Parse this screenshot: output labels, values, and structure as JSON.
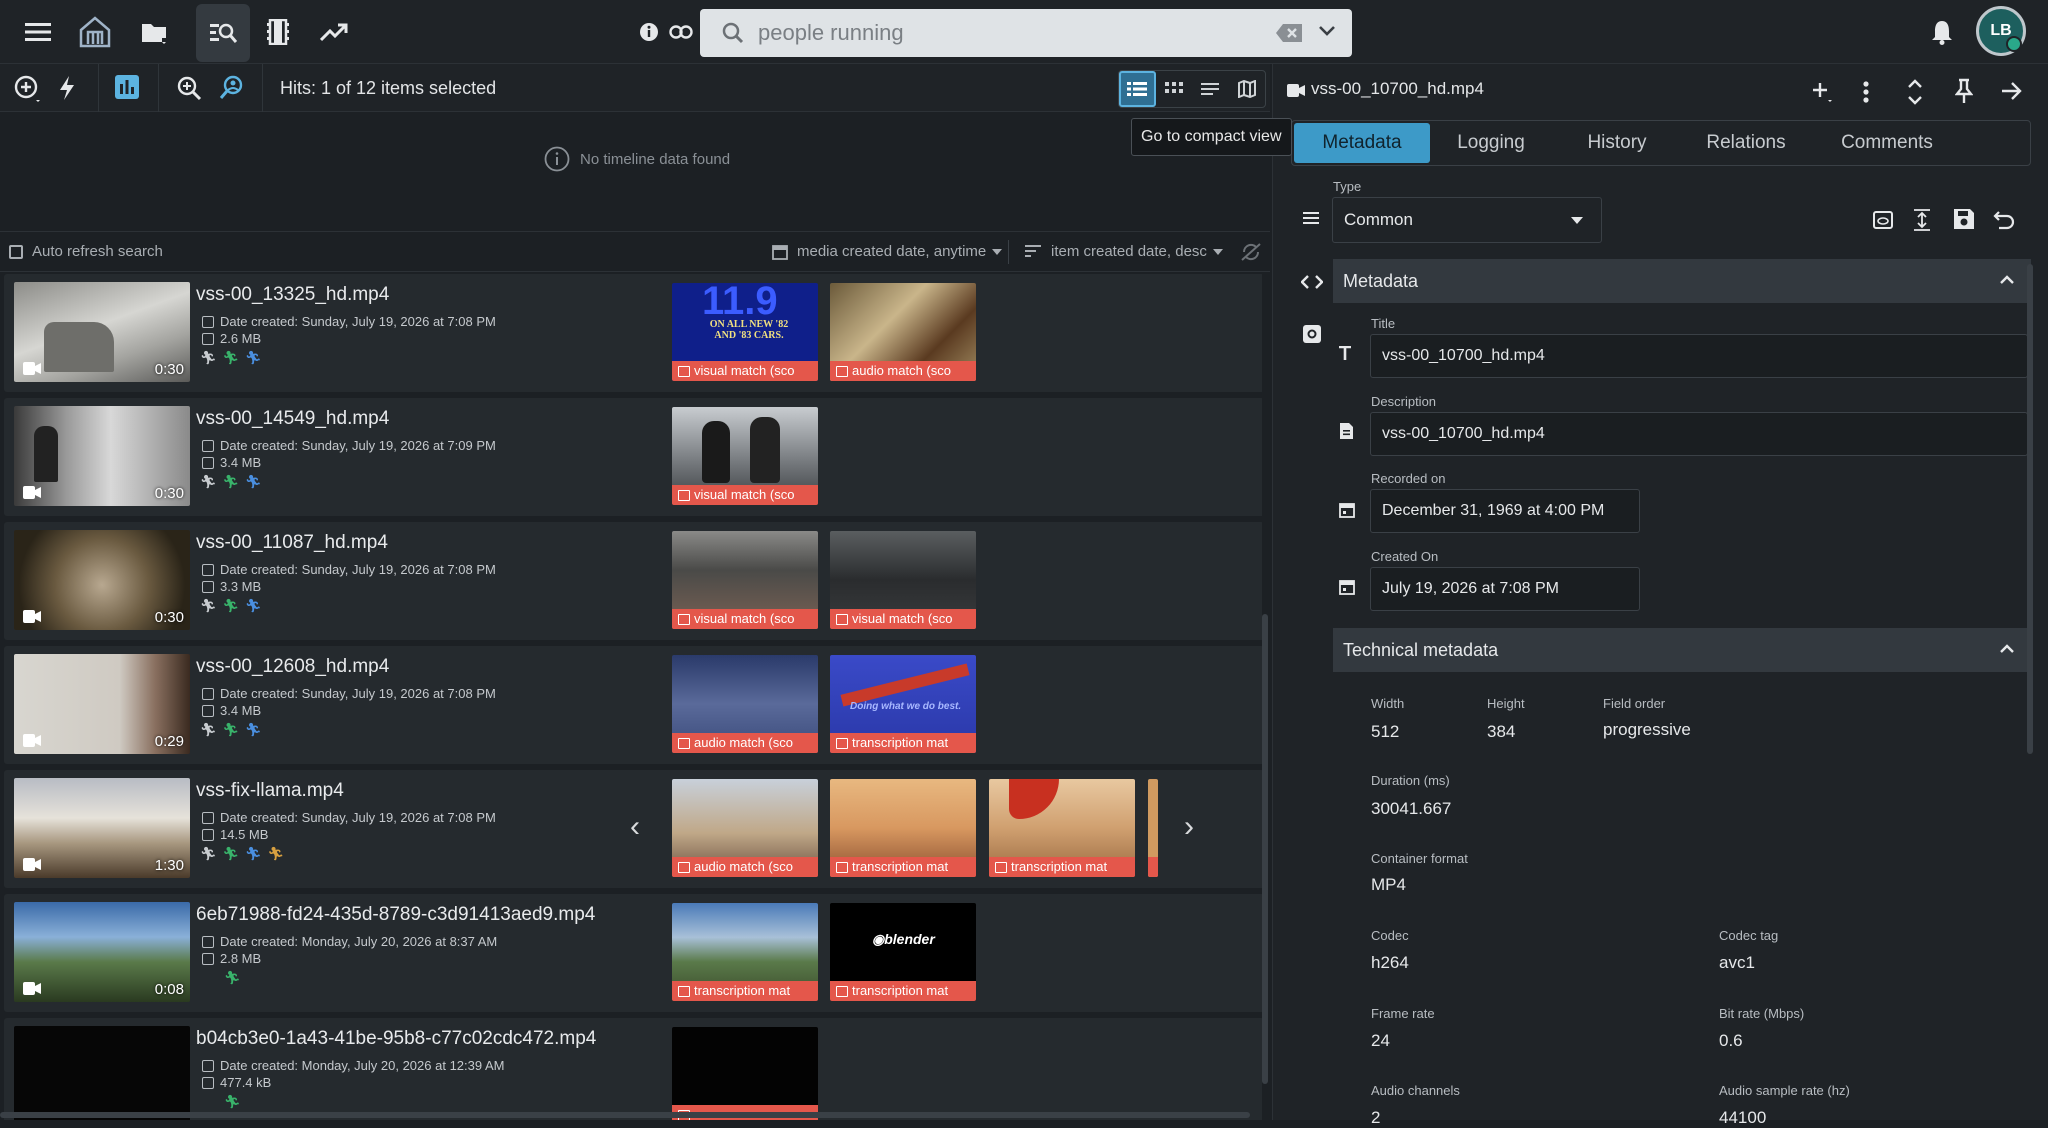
{
  "search": {
    "placeholder": "people running"
  },
  "user": {
    "initials": "LB"
  },
  "toolbar": {
    "hits": "Hits: 1 of 12 items selected",
    "tooltip": "Go to compact view"
  },
  "timeline": {
    "empty": "No timeline data found"
  },
  "filters": {
    "auto_refresh": "Auto refresh search",
    "date_filter": "media created date, anytime",
    "sort": "item created date, desc"
  },
  "results": [
    {
      "name": "vss-00_13325_hd.mp4",
      "date": "Date created: Sunday, July 19, 2026 at 7:08 PM",
      "size": "2.6 MB",
      "duration": "0:30",
      "matches": [
        "visual match (sco",
        "audio match (sco"
      ]
    },
    {
      "name": "vss-00_14549_hd.mp4",
      "date": "Date created: Sunday, July 19, 2026 at 7:09 PM",
      "size": "3.4 MB",
      "duration": "0:30",
      "matches": [
        "visual match (sco"
      ]
    },
    {
      "name": "vss-00_11087_hd.mp4",
      "date": "Date created: Sunday, July 19, 2026 at 7:08 PM",
      "size": "3.3 MB",
      "duration": "0:30",
      "matches": [
        "visual match (sco",
        "visual match (sco"
      ]
    },
    {
      "name": "vss-00_12608_hd.mp4",
      "date": "Date created: Sunday, July 19, 2026 at 7:08 PM",
      "size": "3.4 MB",
      "duration": "0:29",
      "matches": [
        "audio match (sco",
        "transcription mat"
      ]
    },
    {
      "name": "vss-fix-llama.mp4",
      "date": "Date created: Sunday, July 19, 2026 at 7:08 PM",
      "size": "14.5 MB",
      "duration": "1:30",
      "matches": [
        "audio match (sco",
        "transcription mat",
        "transcription mat"
      ]
    },
    {
      "name": "6eb71988-fd24-435d-8789-c3d91413aed9.mp4",
      "date": "Date created: Monday, July 20, 2026 at 8:37 AM",
      "size": "2.8 MB",
      "duration": "0:08",
      "matches": [
        "transcription mat",
        "transcription mat"
      ]
    },
    {
      "name": "b04cb3e0-1a43-41be-95b8-c77c02cdc472.mp4",
      "date": "Date created: Monday, July 20, 2026 at 12:39 AM",
      "size": "477.4 kB",
      "duration": "",
      "matches": [
        ""
      ]
    }
  ],
  "match_thumb_texts": {
    "ad_number": "11.9",
    "ad_line": "ON ALL NEW '82 AND '83 CARS.",
    "plane_caption": "Doing what we do best.",
    "blender_logo": "blender"
  },
  "detail": {
    "filename": "vss-00_10700_hd.mp4",
    "tabs": [
      "Metadata",
      "Logging",
      "History",
      "Relations",
      "Comments"
    ],
    "type_label": "Type",
    "type_value": "Common",
    "metadata_section": "Metadata",
    "title_label": "Title",
    "title_value": "vss-00_10700_hd.mp4",
    "description_label": "Description",
    "description_value": "vss-00_10700_hd.mp4",
    "recorded_label": "Recorded on",
    "recorded_value": "December 31, 1969 at 4:00 PM",
    "created_label": "Created On",
    "created_value": "July 19, 2026 at 7:08 PM",
    "technical_section": "Technical metadata",
    "width_label": "Width",
    "width_value": "512",
    "height_label": "Height",
    "height_value": "384",
    "field_order_label": "Field order",
    "field_order_value": "progressive",
    "duration_label": "Duration (ms)",
    "duration_value": "30041.667",
    "container_label": "Container format",
    "container_value": "MP4",
    "codec_label": "Codec",
    "codec_value": "h264",
    "codec_tag_label": "Codec tag",
    "codec_tag_value": "avc1",
    "frame_rate_label": "Frame rate",
    "frame_rate_value": "24",
    "bit_rate_label": "Bit rate (Mbps)",
    "bit_rate_value": "0.6",
    "audio_channels_label": "Audio channels",
    "audio_channels_value": "2",
    "audio_sample_label": "Audio sample rate (hz)",
    "audio_sample_value": "44100"
  },
  "colors": {
    "accent": "#3d9ac8",
    "match_label": "#e4574b",
    "background": "#1c2024"
  }
}
